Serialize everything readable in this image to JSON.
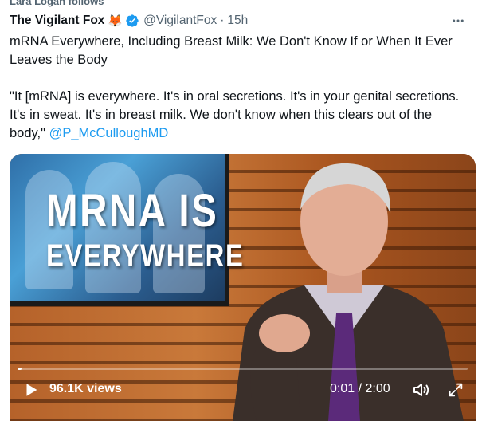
{
  "tweet": {
    "social_context": "Lara Logan follows",
    "author": {
      "display_name": "The Vigilant Fox",
      "emoji": "🦊",
      "handle": "@VigilantFox",
      "separator": "·",
      "time": "15h",
      "verified_icon": "verified-badge-icon"
    },
    "more_icon": "more-options-icon",
    "text": {
      "headline": "mRNA Everywhere, Including Breast Milk: We Don't Know If or When It Ever Leaves the Body",
      "quote": "\"It [mRNA] is everywhere. It's in oral secretions. It's in your genital secretions. It's in sweat. It's in breast milk. We don't know when this clears out of the body,\" ",
      "mention": "@P_McCulloughMD"
    },
    "video": {
      "overlay_line1": "MRNA IS",
      "overlay_line2": "EVERYWHERE",
      "views": "96.1K views",
      "timecode": "0:01 / 2:00",
      "progress": 0.008,
      "icons": {
        "play": "play-icon",
        "volume": "volume-icon",
        "fullscreen": "fullscreen-icon"
      }
    }
  },
  "colors": {
    "text_primary": "#0f1419",
    "text_secondary": "#536471",
    "link": "#1d9bf0",
    "verified": "#1d9bf0"
  }
}
